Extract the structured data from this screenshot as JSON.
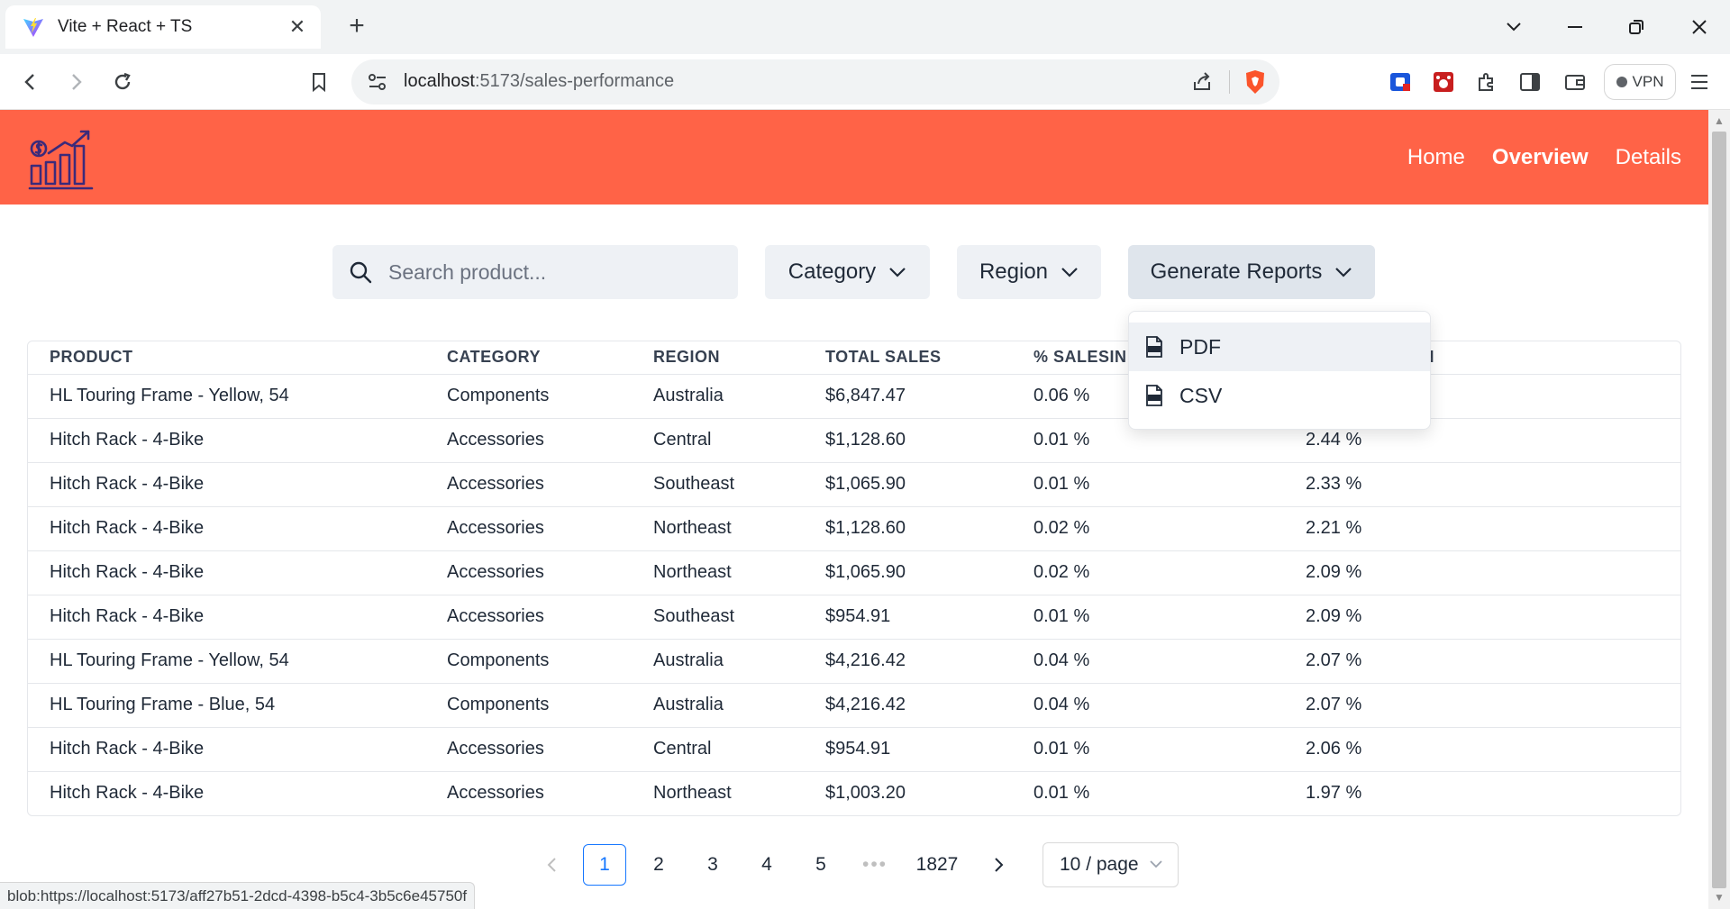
{
  "browser": {
    "tab_title": "Vite + React + TS",
    "url_host": "localhost",
    "url_path": ":5173/sales-performance",
    "vpn_label": "VPN",
    "status_url": "blob:https://localhost:5173/aff27b51-2dcd-4398-b5c4-3b5c6e45750f"
  },
  "nav": {
    "home": "Home",
    "overview": "Overview",
    "details": "Details"
  },
  "filters": {
    "search_placeholder": "Search product...",
    "category": "Category",
    "region": "Region",
    "reports": "Generate Reports"
  },
  "reports_menu": {
    "pdf": "PDF",
    "csv": "CSV"
  },
  "table": {
    "headers": [
      "PRODUCT",
      "CATEGORY",
      "REGION",
      "TOTAL SALES",
      "% SALESIN",
      "ALESINREGION"
    ],
    "rows": [
      [
        "HL Touring Frame - Yellow, 54",
        "Components",
        "Australia",
        "$6,847.47",
        "0.06 %",
        ""
      ],
      [
        "Hitch Rack - 4-Bike",
        "Accessories",
        "Central",
        "$1,128.60",
        "0.01 %",
        "2.44 %"
      ],
      [
        "Hitch Rack - 4-Bike",
        "Accessories",
        "Southeast",
        "$1,065.90",
        "0.01 %",
        "2.33 %"
      ],
      [
        "Hitch Rack - 4-Bike",
        "Accessories",
        "Northeast",
        "$1,128.60",
        "0.02 %",
        "2.21 %"
      ],
      [
        "Hitch Rack - 4-Bike",
        "Accessories",
        "Northeast",
        "$1,065.90",
        "0.02 %",
        "2.09 %"
      ],
      [
        "Hitch Rack - 4-Bike",
        "Accessories",
        "Southeast",
        "$954.91",
        "0.01 %",
        "2.09 %"
      ],
      [
        "HL Touring Frame - Yellow, 54",
        "Components",
        "Australia",
        "$4,216.42",
        "0.04 %",
        "2.07 %"
      ],
      [
        "HL Touring Frame - Blue, 54",
        "Components",
        "Australia",
        "$4,216.42",
        "0.04 %",
        "2.07 %"
      ],
      [
        "Hitch Rack - 4-Bike",
        "Accessories",
        "Central",
        "$954.91",
        "0.01 %",
        "2.06 %"
      ],
      [
        "Hitch Rack - 4-Bike",
        "Accessories",
        "Northeast",
        "$1,003.20",
        "0.01 %",
        "1.97 %"
      ]
    ]
  },
  "pagination": {
    "pages": [
      "1",
      "2",
      "3",
      "4",
      "5"
    ],
    "ellipsis": "•••",
    "last_page": "1827",
    "current": "1",
    "page_size": "10 / page"
  },
  "colors": {
    "header_bg": "#ff6347",
    "accent": "#1677ff"
  }
}
